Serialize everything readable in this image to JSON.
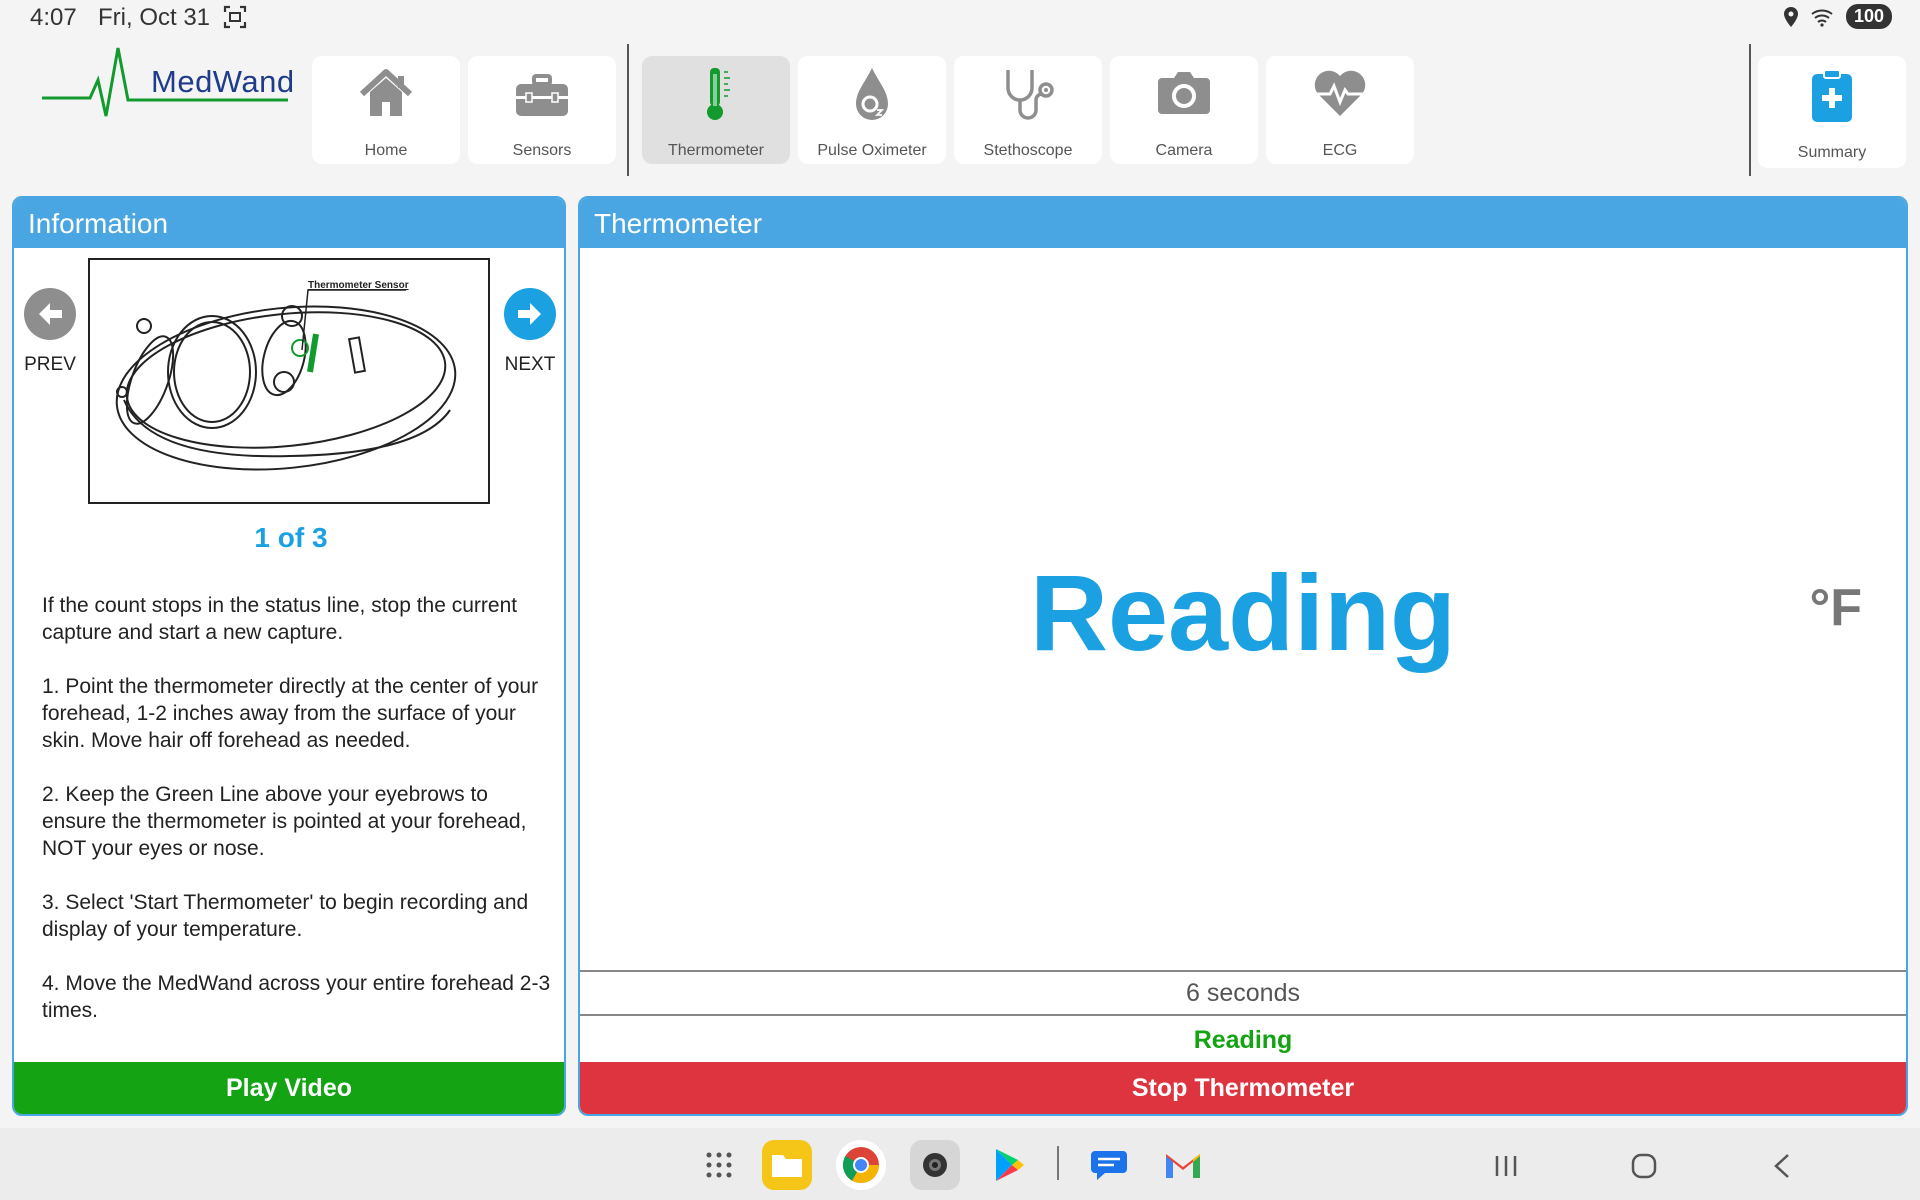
{
  "status_bar": {
    "time": "4:07",
    "date": "Fri, Oct 31",
    "battery": "100"
  },
  "brand": {
    "name": "MedWand"
  },
  "nav": {
    "items": [
      {
        "label": "Home",
        "icon": "home-icon"
      },
      {
        "label": "Sensors",
        "icon": "toolbox-icon"
      },
      {
        "label": "Thermometer",
        "icon": "thermometer-icon",
        "active": true
      },
      {
        "label": "Pulse Oximeter",
        "icon": "oxygen-drop-icon"
      },
      {
        "label": "Stethoscope",
        "icon": "stethoscope-icon"
      },
      {
        "label": "Camera",
        "icon": "camera-icon"
      },
      {
        "label": "ECG",
        "icon": "heart-pulse-icon"
      }
    ],
    "summary": {
      "label": "Summary",
      "icon": "clipboard-plus-icon"
    }
  },
  "info_panel": {
    "title": "Information",
    "prev_label": "PREV",
    "next_label": "NEXT",
    "diagram_label": "Thermometer Sensor",
    "page_indicator": "1 of 3",
    "instructions": [
      "If the count stops in the status line, stop the current capture and start a new capture.",
      "1. Point the thermometer directly at the center of your forehead, 1-2 inches away from the surface of your skin. Move hair off forehead as needed.",
      "2. Keep the Green Line above your eyebrows to ensure the thermometer is pointed at your forehead, NOT your eyes or nose.",
      "3. Select 'Start Thermometer' to begin recording and display of your temperature.",
      "4. Move the MedWand across your entire forehead 2-3 times."
    ],
    "play_video_label": "Play Video"
  },
  "thermo_panel": {
    "title": "Thermometer",
    "reading": "Reading",
    "unit": "°F",
    "seconds": "6  seconds",
    "status": "Reading",
    "stop_label": "Stop Thermometer"
  },
  "colors": {
    "accent_blue": "#4aa6e3",
    "reading_blue": "#1ba1e2",
    "green": "#13a313",
    "red": "#de3440"
  }
}
